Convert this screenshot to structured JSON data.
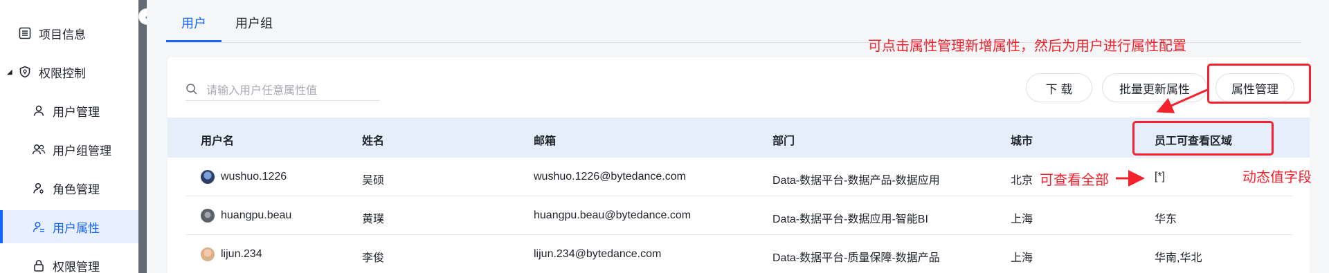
{
  "sidebar": {
    "items": [
      {
        "label": "项目信息",
        "icon": "list-icon"
      },
      {
        "label": "权限控制",
        "icon": "shield-icon"
      },
      {
        "label": "用户管理",
        "icon": "user-icon"
      },
      {
        "label": "用户组管理",
        "icon": "user-group-icon"
      },
      {
        "label": "角色管理",
        "icon": "role-icon"
      },
      {
        "label": "用户属性",
        "icon": "user-attribute-icon"
      },
      {
        "label": "权限管理",
        "icon": "lock-icon"
      }
    ]
  },
  "tabs": [
    {
      "label": "用户",
      "active": true
    },
    {
      "label": "用户组",
      "active": false
    }
  ],
  "search": {
    "placeholder": "请输入用户任意属性值"
  },
  "toolbar": {
    "download": "下 载",
    "bulk_update": "批量更新属性",
    "attr_manage": "属性管理"
  },
  "table": {
    "columns": [
      "用户名",
      "姓名",
      "邮箱",
      "部门",
      "城市",
      "员工可查看区域"
    ],
    "rows": [
      {
        "username": "wushuo.1226",
        "name": "吴硕",
        "email": "wushuo.1226@bytedance.com",
        "dept": "Data-数据平台-数据产品-数据应用",
        "city": "北京",
        "region": "[*]"
      },
      {
        "username": "huangpu.beau",
        "name": "黄璞",
        "email": "huangpu.beau@bytedance.com",
        "dept": "Data-数据平台-数据应用-智能BI",
        "city": "上海",
        "region": "华东"
      },
      {
        "username": "lijun.234",
        "name": "李俊",
        "email": "lijun.234@bytedance.com",
        "dept": "Data-数据平台-质量保障-数据产品",
        "city": "上海",
        "region": "华南,华北"
      }
    ]
  },
  "annotations": {
    "top": "可点击属性管理新增属性，然后为用户进行属性配置",
    "view_all": "可查看全部",
    "dynamic": "动态值字段"
  },
  "colors": {
    "accent": "#1664ff",
    "annotation": "#f5222d",
    "header_bg": "#e6eefc"
  }
}
